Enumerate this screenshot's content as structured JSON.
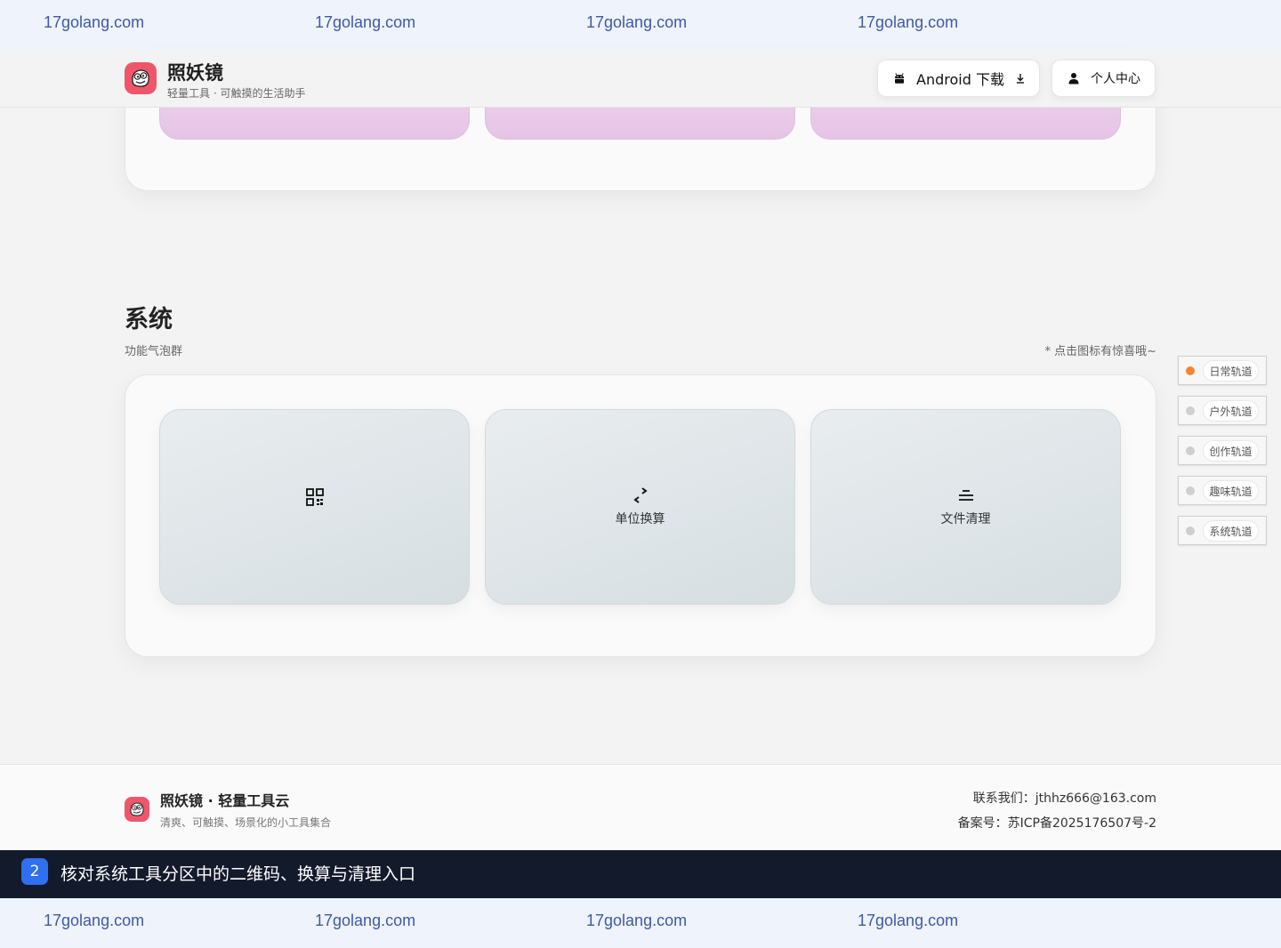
{
  "watermark": {
    "top": [
      "17golang.com",
      "17golang.com",
      "17golang.com",
      "17golang.com"
    ],
    "bottom": [
      "17golang.com",
      "17golang.com",
      "17golang.com",
      "17golang.com"
    ]
  },
  "header": {
    "brand_name": "照妖镜",
    "brand_sub": "轻量工具 · 可触摸的生活助手",
    "android_label": "Android 下载",
    "user_label": "个人中心"
  },
  "section": {
    "title": "系统",
    "subtitle": "功能气泡群",
    "hint": "* 点击图标有惊喜哦~"
  },
  "tools": [
    {
      "label": "",
      "icon": "qr-code-icon"
    },
    {
      "label": "单位换算",
      "icon": "swap-arrows-icon"
    },
    {
      "label": "文件清理",
      "icon": "clean-lines-icon"
    }
  ],
  "nav": [
    {
      "label": "日常轨道",
      "active": true
    },
    {
      "label": "户外轨道",
      "active": false
    },
    {
      "label": "创作轨道",
      "active": false
    },
    {
      "label": "趣味轨道",
      "active": false
    },
    {
      "label": "系统轨道",
      "active": false
    }
  ],
  "footer": {
    "title": "照妖镜 · 轻量工具云",
    "subtitle": "清爽、可触摸、场景化的小工具集合",
    "contact": "联系我们：jthhz666@163.com",
    "icp": "备案号：苏ICP备2025176507号-2"
  },
  "caption": {
    "number": "2",
    "text": "核对系统工具分区中的二维码、换算与清理入口"
  },
  "colors": {
    "brand": "#f0566a",
    "active_dot": "#f5872a",
    "caption_bg": "#131a2c",
    "caption_badge": "#2f6ff0"
  }
}
